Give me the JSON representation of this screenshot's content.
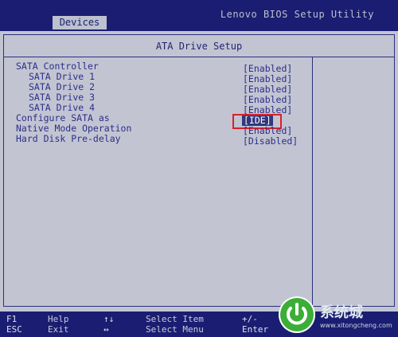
{
  "header": {
    "app_title": "Lenovo BIOS Setup Utility",
    "active_tab": "Devices"
  },
  "panel": {
    "title": "ATA Drive Setup",
    "settings": [
      {
        "label": "SATA Controller",
        "value": "[Enabled]",
        "indent": 0,
        "highlighted": false
      },
      {
        "label": "SATA Drive 1",
        "value": "[Enabled]",
        "indent": 1,
        "highlighted": false
      },
      {
        "label": "SATA Drive 2",
        "value": "[Enabled]",
        "indent": 1,
        "highlighted": false
      },
      {
        "label": "SATA Drive 3",
        "value": "[Enabled]",
        "indent": 1,
        "highlighted": false
      },
      {
        "label": "SATA Drive 4",
        "value": "[Enabled]",
        "indent": 1,
        "highlighted": false
      },
      {
        "label": "Configure SATA as",
        "value": "[IDE]",
        "indent": 0,
        "highlighted": true
      },
      {
        "label": "Native Mode Operation",
        "value": "[Enabled]",
        "indent": 0,
        "highlighted": false
      },
      {
        "label": "Hard Disk Pre-delay",
        "value": "[Disabled]",
        "indent": 0,
        "highlighted": false
      }
    ]
  },
  "footer": {
    "keys": [
      {
        "key": "F1",
        "action": "Help"
      },
      {
        "key": "ESC",
        "action": "Exit"
      },
      {
        "key": "↑↓",
        "action": "Select Item"
      },
      {
        "key": "↔",
        "action": "Select Menu"
      },
      {
        "key": "+/-",
        "action": ""
      },
      {
        "key": "Enter",
        "action": ""
      }
    ]
  },
  "watermark": {
    "text": "系统城",
    "sub": "www.xitongcheng.com",
    "icon": "power-icon"
  }
}
